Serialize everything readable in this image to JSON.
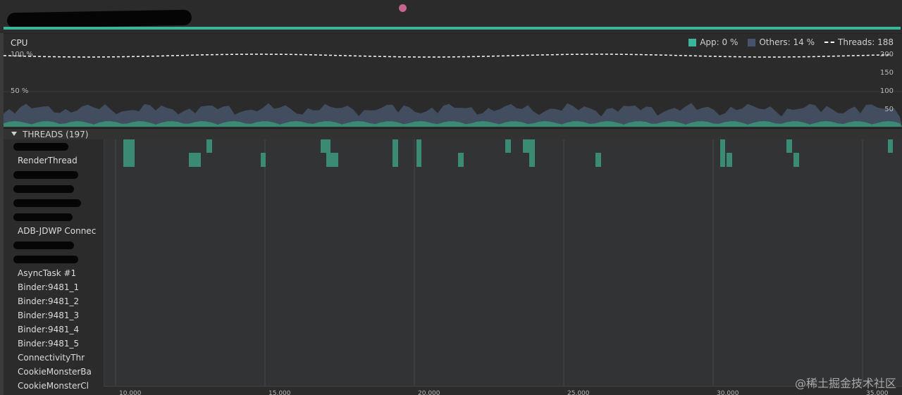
{
  "colors": {
    "app": "#3ab59a",
    "others": "#47536a",
    "threads_line": "#ffffff",
    "thread_activity": "#3b8a74",
    "event_dot": "#c4668d"
  },
  "cpu": {
    "title": "CPU",
    "legend": {
      "app": "App: 0 %",
      "others": "Others: 14 %",
      "threads": "Threads: 188"
    },
    "left_axis": [
      "100 %",
      "50 %"
    ],
    "right_axis": [
      "200",
      "150",
      "100",
      "50"
    ]
  },
  "threads": {
    "header": "THREADS (197)",
    "rows": [
      {
        "label": "",
        "redacted": true
      },
      {
        "label": "RenderThread",
        "redacted": false
      },
      {
        "label": "",
        "redacted": true
      },
      {
        "label": "",
        "redacted": true
      },
      {
        "label": "",
        "redacted": true
      },
      {
        "label": "",
        "redacted": true
      },
      {
        "label": "ADB-JDWP Connec",
        "redacted": false
      },
      {
        "label": "",
        "redacted": true
      },
      {
        "label": "",
        "redacted": true
      },
      {
        "label": "AsyncTask #1",
        "redacted": false
      },
      {
        "label": "Binder:9481_1",
        "redacted": false
      },
      {
        "label": "Binder:9481_2",
        "redacted": false
      },
      {
        "label": "Binder:9481_3",
        "redacted": false
      },
      {
        "label": "Binder:9481_4",
        "redacted": false
      },
      {
        "label": "Binder:9481_5",
        "redacted": false
      },
      {
        "label": "ConnectivityThr",
        "redacted": false
      },
      {
        "label": "CookieMonsterBa",
        "redacted": false
      },
      {
        "label": "CookieMonsterCl",
        "redacted": false
      }
    ]
  },
  "time_axis": {
    "labels": [
      "10.000",
      "15.000",
      "20.000",
      "25.000",
      "30.000",
      "35.000"
    ]
  },
  "watermark": "@稀土掘金技术社区"
}
